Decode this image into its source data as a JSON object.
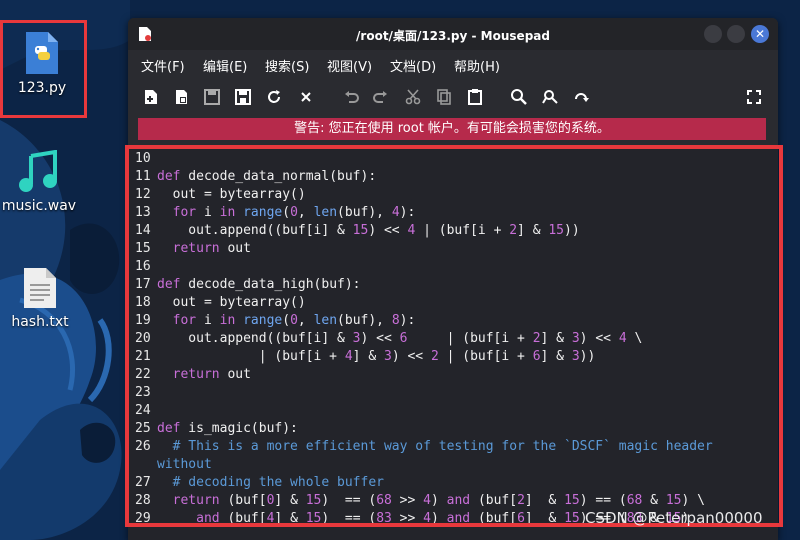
{
  "desktop": {
    "icons": [
      {
        "label": "123.py",
        "icon": "python-file-icon"
      },
      {
        "label": "music.wav",
        "icon": "music-file-icon"
      },
      {
        "label": "hash.txt",
        "icon": "text-file-icon"
      }
    ]
  },
  "window": {
    "title": "/root/桌面/123.py - Mousepad",
    "menu": [
      "文件(F)",
      "编辑(E)",
      "搜索(S)",
      "视图(V)",
      "文档(D)",
      "帮助(H)"
    ],
    "toolbar_icons": [
      "new-document-icon",
      "new-window-icon",
      "save-icon",
      "save-as-icon",
      "reload-icon",
      "close-doc-icon",
      "undo-icon",
      "redo-icon",
      "cut-icon",
      "copy-icon",
      "paste-icon",
      "find-icon",
      "find-replace-icon",
      "goto-icon",
      "fullscreen-icon"
    ],
    "warning": "警告: 您正在使用 root 帐户。有可能会损害您的系统。"
  },
  "editor": {
    "lines": [
      {
        "n": "10",
        "t": ""
      },
      {
        "n": "11",
        "t": "def decode_data_normal(buf):"
      },
      {
        "n": "12",
        "t": "  out = bytearray()"
      },
      {
        "n": "13",
        "t": "  for i in range(0, len(buf), 4):"
      },
      {
        "n": "14",
        "t": "    out.append((buf[i] & 15) << 4 | (buf[i + 2] & 15))"
      },
      {
        "n": "15",
        "t": "  return out"
      },
      {
        "n": "16",
        "t": ""
      },
      {
        "n": "17",
        "t": "def decode_data_high(buf):"
      },
      {
        "n": "18",
        "t": "  out = bytearray()"
      },
      {
        "n": "19",
        "t": "  for i in range(0, len(buf), 8):"
      },
      {
        "n": "20",
        "t": "    out.append((buf[i] & 3) << 6     | (buf[i + 2] & 3) << 4 \\"
      },
      {
        "n": "21",
        "t": "             | (buf[i + 4] & 3) << 2 | (buf[i + 6] & 3))"
      },
      {
        "n": "22",
        "t": "  return out"
      },
      {
        "n": "23",
        "t": ""
      },
      {
        "n": "24",
        "t": ""
      },
      {
        "n": "25",
        "t": "def is_magic(buf):"
      },
      {
        "n": "26",
        "t": "  # This is a more efficient way of testing for the `DSCF` magic header"
      },
      {
        "n": "",
        "t": "without"
      },
      {
        "n": "27",
        "t": "  # decoding the whole buffer"
      },
      {
        "n": "28",
        "t": "  return (buf[0] & 15)  == (68 >> 4) and (buf[2]  & 15) == (68 & 15) \\"
      },
      {
        "n": "29",
        "t": "     and (buf[4] & 15)  == (83 >> 4) and (buf[6]  & 15) == (83 & 15)"
      }
    ]
  },
  "watermark": "CSDN @Peterpan00000",
  "colors": {
    "keyword": "#c86fd8",
    "function": "#7ea9f2",
    "comment": "#5b9ad8",
    "warning_bg": "#b62a4b",
    "highlight_border": "#e8383c"
  }
}
